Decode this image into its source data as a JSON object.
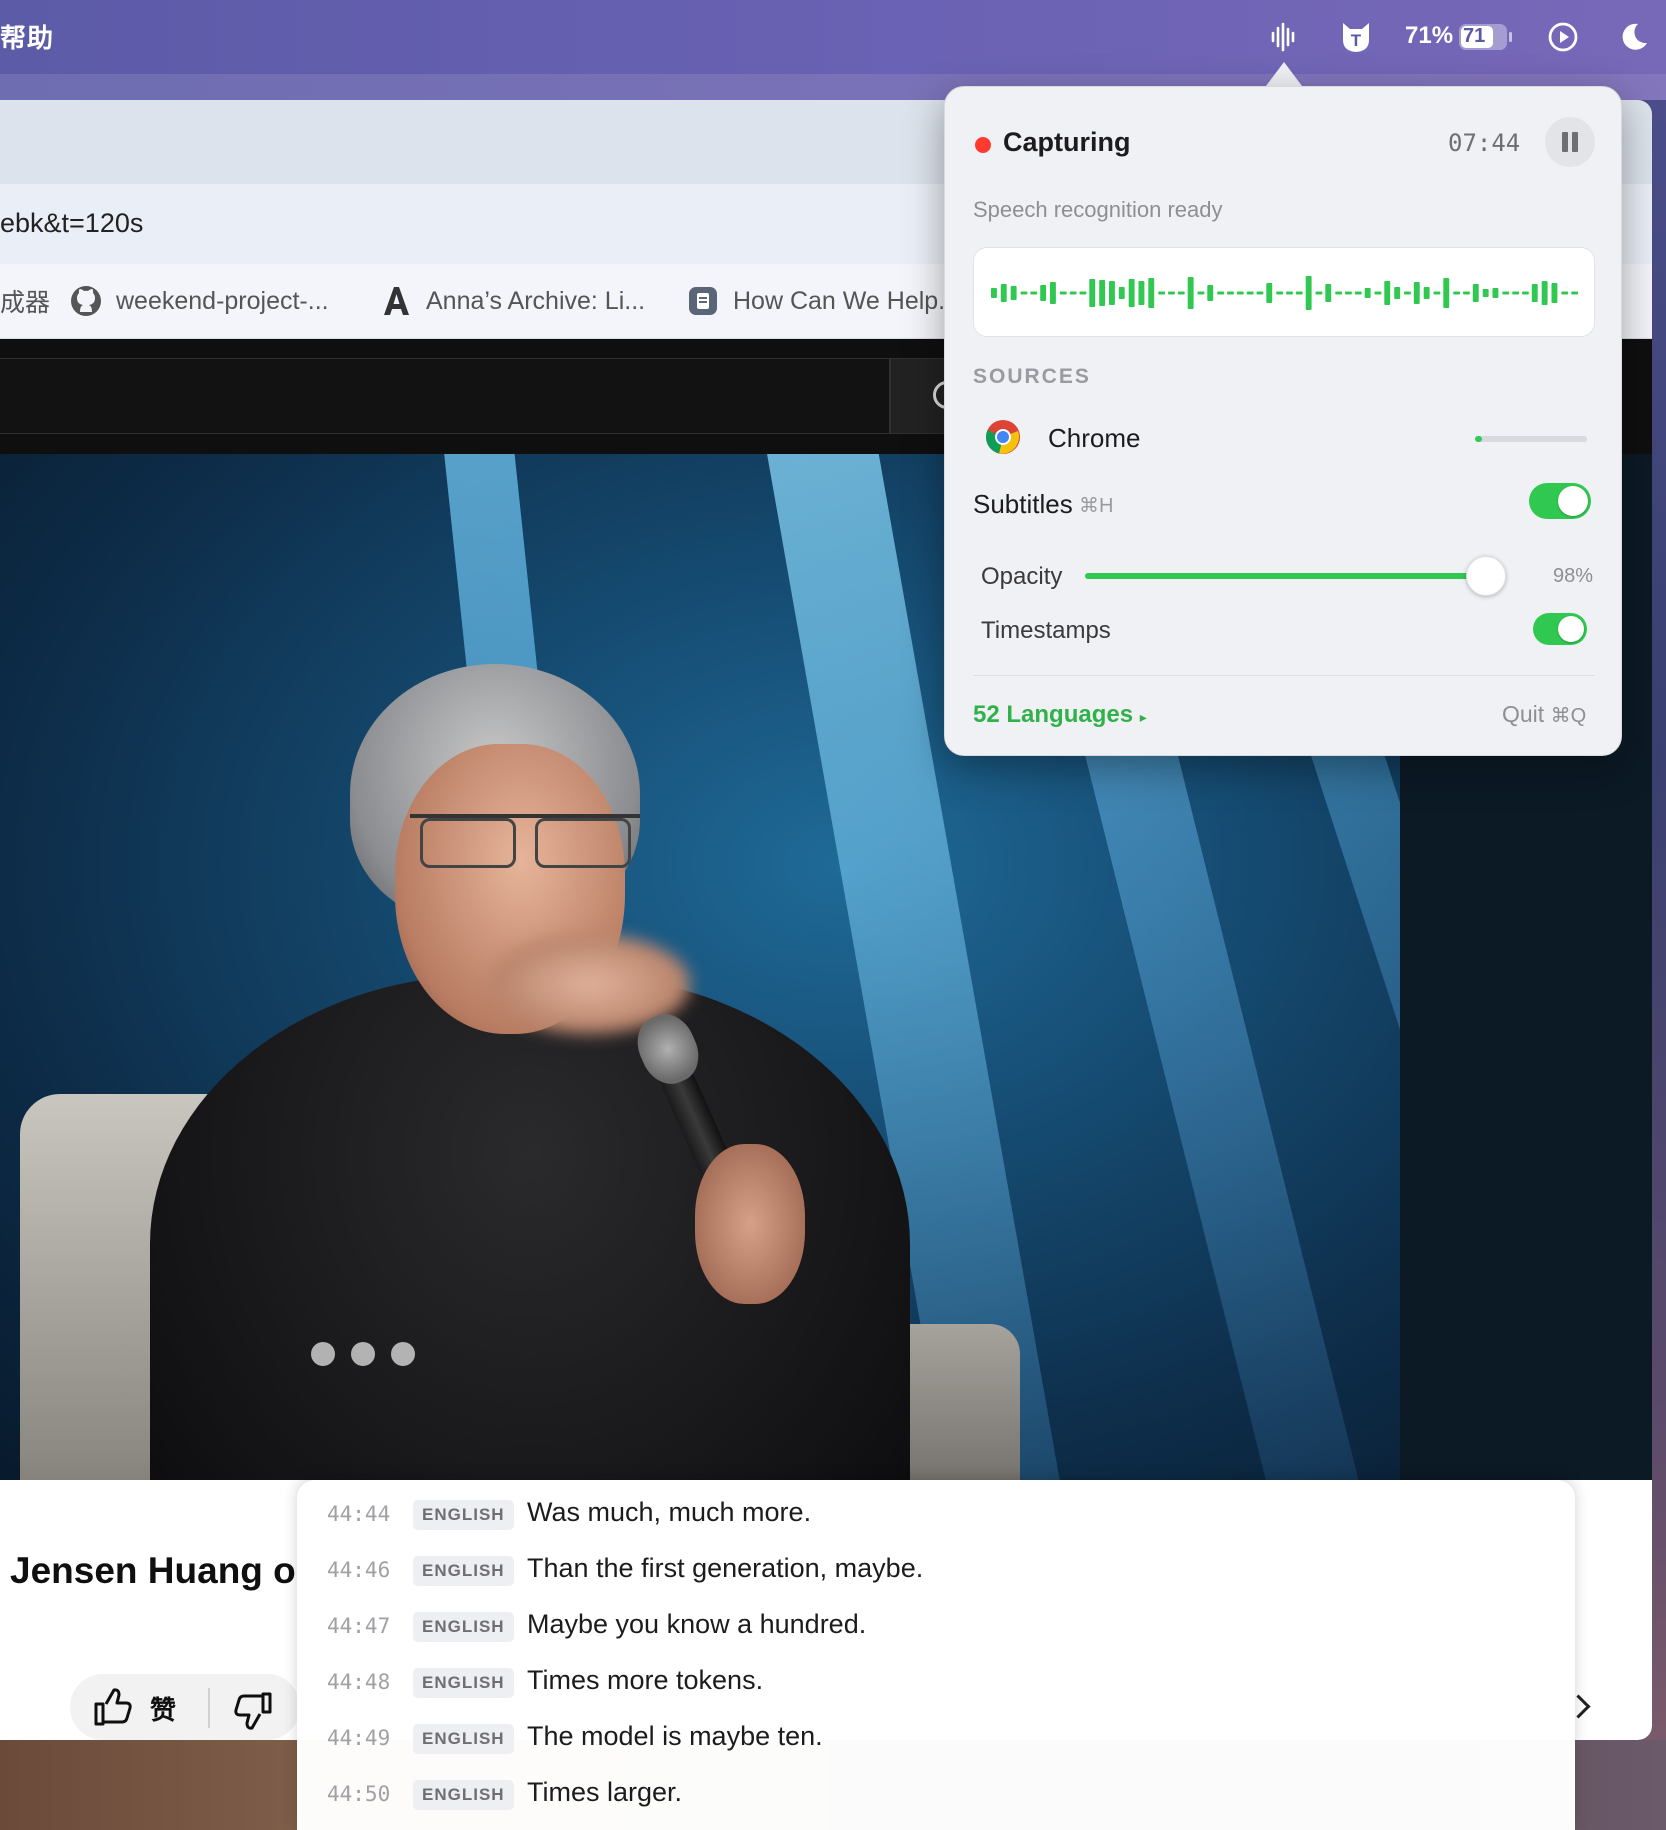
{
  "menubar": {
    "left_fragment": "帮助",
    "battery_percent": "71%",
    "battery_level": "71",
    "icons": [
      "waveform-icon",
      "cat-shield-icon",
      "battery-icon",
      "play-circle-icon",
      "moon-icon"
    ]
  },
  "browser": {
    "url_fragment": "ebk&t=120s",
    "bookmarks": [
      {
        "label": "成器",
        "icon": "bookmark-icon"
      },
      {
        "label": "weekend-project-...",
        "icon": "github-icon"
      },
      {
        "label": "Anna’s Archive: Li...",
        "icon": "annas-archive-icon"
      },
      {
        "label": "How Can We Help...",
        "icon": "help-doc-icon"
      }
    ]
  },
  "video": {
    "title_fragment": "Jensen Huang o",
    "like_label": "赞"
  },
  "popover": {
    "status": "Capturing",
    "timer": "07:44",
    "subtitle": "Speech recognition ready",
    "sources_heading": "SOURCES",
    "source_name": "Chrome",
    "source_level": 0.06,
    "subtitles_label": "Subtitles",
    "subtitles_shortcut": "⌘H",
    "subtitles_on": true,
    "opacity_label": "Opacity",
    "opacity_value": 0.98,
    "opacity_text": "98%",
    "timestamps_label": "Timestamps",
    "timestamps_on": true,
    "languages_label": "52 Languages",
    "languages_chevron": "▸",
    "quit_label": "Quit",
    "quit_shortcut": "⌘Q",
    "accent_color": "#30c850",
    "record_color": "#ff3b30"
  },
  "subtitles": [
    {
      "time": "44:44",
      "lang": "ENGLISH",
      "text": "Was much, much more."
    },
    {
      "time": "44:46",
      "lang": "ENGLISH",
      "text": "Than the first generation, maybe."
    },
    {
      "time": "44:47",
      "lang": "ENGLISH",
      "text": "Maybe you know a hundred."
    },
    {
      "time": "44:48",
      "lang": "ENGLISH",
      "text": "Times more tokens."
    },
    {
      "time": "44:49",
      "lang": "ENGLISH",
      "text": "The model is maybe ten."
    },
    {
      "time": "44:50",
      "lang": "ENGLISH",
      "text": "Times larger."
    }
  ]
}
